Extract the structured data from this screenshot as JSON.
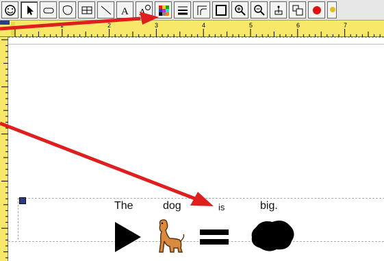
{
  "toolbar": {
    "tools": [
      {
        "name": "face-tool-icon"
      },
      {
        "name": "pointer-tool-icon"
      },
      {
        "name": "rectangle-tool-icon"
      },
      {
        "name": "blob-tool-icon"
      },
      {
        "name": "grid-tool-icon"
      },
      {
        "name": "line-tool-icon"
      },
      {
        "name": "text-tool-icon"
      },
      {
        "name": "symbol-text-tool-icon"
      },
      {
        "name": "color-palette-icon"
      },
      {
        "name": "line-thickness-icon"
      },
      {
        "name": "corner-style-icon"
      },
      {
        "name": "frame-icon"
      },
      {
        "name": "zoom-in-icon"
      },
      {
        "name": "zoom-out-icon"
      },
      {
        "name": "anchor-icon"
      },
      {
        "name": "arrange-icon"
      },
      {
        "name": "record-icon"
      },
      {
        "name": "more-icon"
      }
    ]
  },
  "ruler": {
    "labels": [
      "1",
      "2",
      "3",
      "4",
      "5",
      "6",
      "7"
    ]
  },
  "sentence": {
    "words": [
      "The",
      "dog",
      "is",
      "big."
    ],
    "symbols": [
      "play-triangle-symbol",
      "dog-symbol",
      "equals-symbol",
      "big-blob-symbol"
    ]
  },
  "colors": {
    "ruler": "#f7e86a",
    "arrow": "#e01e1e",
    "handle": "#2b3c8f"
  }
}
